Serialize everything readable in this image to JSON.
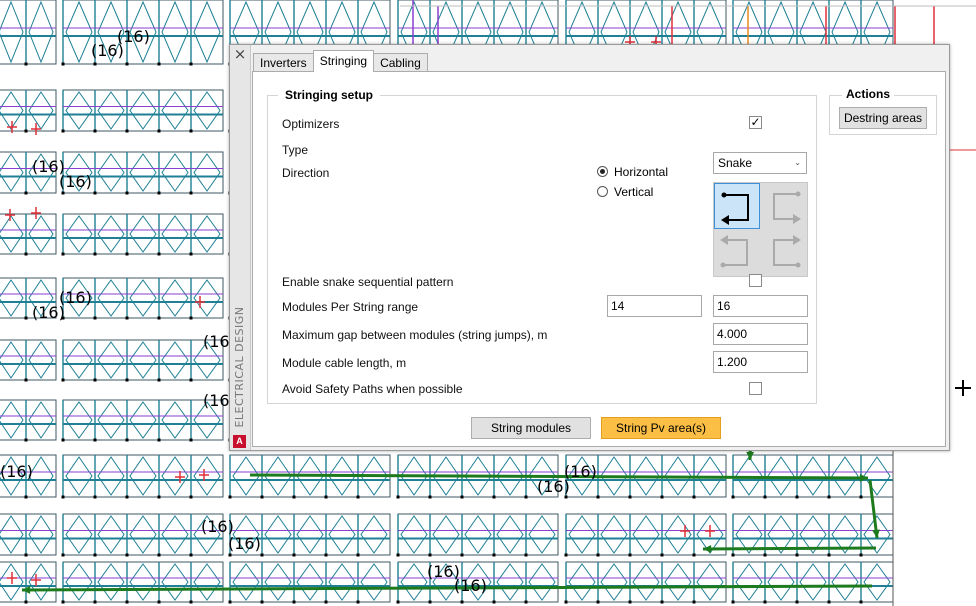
{
  "canvas": {
    "string_labels": [
      "(16)",
      "(16)",
      "(16)",
      "(16)",
      "(16)",
      "(16)",
      "(16",
      "(16",
      "(16)",
      "(16)",
      "(16)",
      "(16)",
      "(16)",
      "(16)",
      "(16)",
      "(16)"
    ]
  },
  "dialog": {
    "close_glyph": "×",
    "side_title": "ELECTRICAL DESIGN",
    "logo_letter": "A",
    "tabs": [
      {
        "label": "Inverters"
      },
      {
        "label": "Stringing",
        "active": true
      },
      {
        "label": "Cabling"
      }
    ],
    "setup": {
      "title": "Stringing setup",
      "optimizers_label": "Optimizers",
      "optimizers_checked": true,
      "check_glyph": "✓",
      "type_label": "Type",
      "type_value": "Snake",
      "direction_label": "Direction",
      "direction_horizontal": "Horizontal",
      "direction_vertical": "Vertical",
      "direction_selected": "Horizontal",
      "snake_pattern_label": "Enable snake sequential pattern",
      "snake_pattern_checked": false,
      "modules_range_label": "Modules Per String range",
      "modules_min": "14",
      "modules_max": "16",
      "max_gap_label": "Maximum gap between modules (string jumps), m",
      "max_gap_value": "4.000",
      "cable_length_label": "Module cable length, m",
      "cable_length_value": "1.200",
      "avoid_paths_label": "Avoid Safety Paths when possible",
      "avoid_paths_checked": false
    },
    "actions": {
      "title": "Actions",
      "destring_label": "Destring areas"
    },
    "footer": {
      "string_modules_label": "String modules",
      "string_pv_label": "String Pv area(s)"
    }
  },
  "colors": {
    "panel_teal": "#1e7f95",
    "string_purple": "#8a3fd1",
    "marker_red": "#e0303a",
    "arrow_green": "#1d7a1d",
    "accent_orange": "#fbbf45",
    "selected_blue": "#cce4f7"
  },
  "icons": {
    "close": "close-icon",
    "check": "check-icon",
    "chevron": "chevron-down-icon",
    "logo": "autocad-logo-icon",
    "crosshair": "crosshair-icon"
  }
}
